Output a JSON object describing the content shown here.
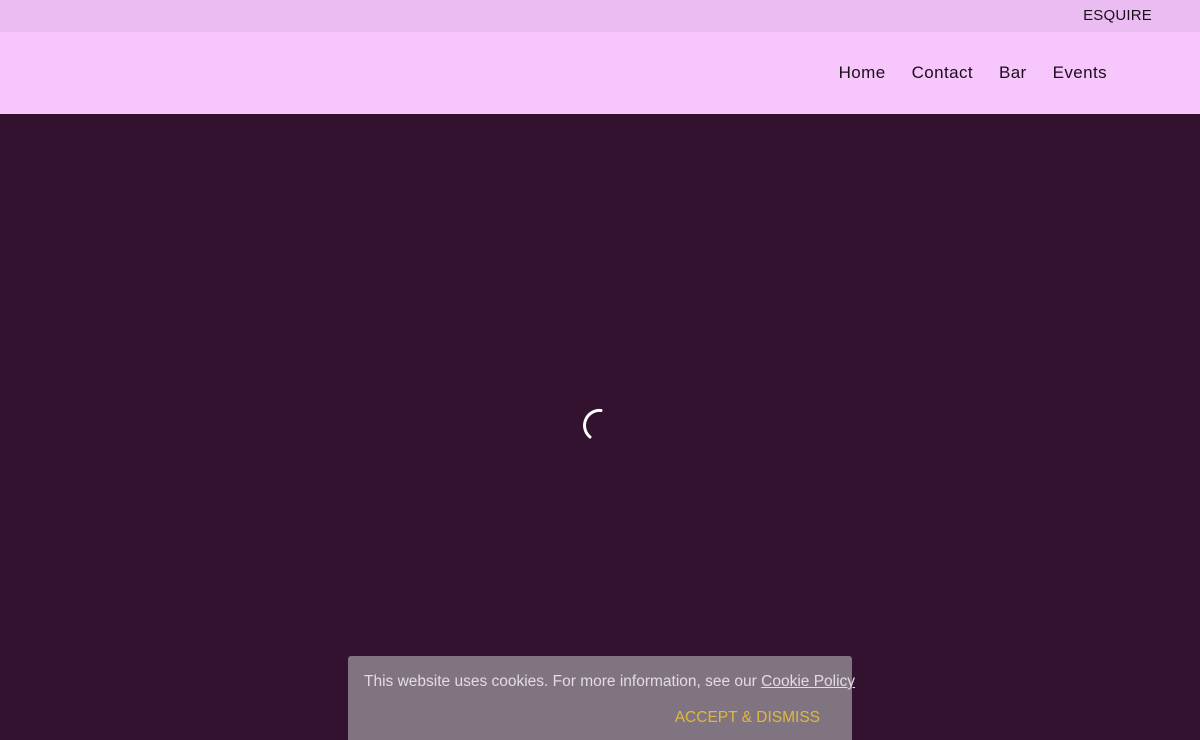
{
  "topbar": {
    "link_label": "ESQUIRE"
  },
  "nav": {
    "items": [
      {
        "label": "Home"
      },
      {
        "label": "Contact"
      },
      {
        "label": "Bar"
      },
      {
        "label": "Events"
      }
    ]
  },
  "hero": {
    "spinner_icon": "loading-spinner-icon"
  },
  "cookie_banner": {
    "message": "This website uses cookies. For more information, see our ",
    "policy_link": "Cookie Policy",
    "accept_label": "ACCEPT & DISMISS"
  },
  "colors": {
    "topbar_bg": "#eabcf1",
    "header_bg": "#f6c6fd",
    "hero_bg": "#33122f",
    "cookie_bg": "#807480",
    "accept_color": "#e0b93c"
  }
}
